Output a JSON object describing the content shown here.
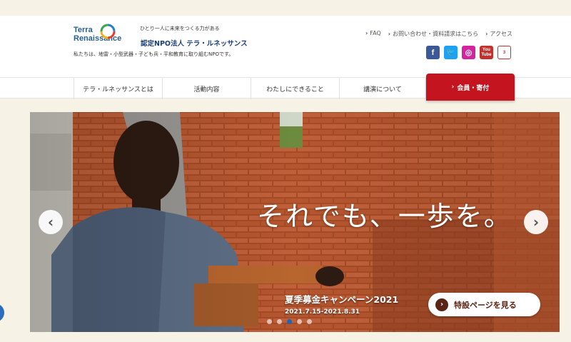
{
  "header": {
    "logo_line1": "Terra",
    "logo_line2": "Renaissance",
    "tagline": "ひとり一人に未来をつくる力がある",
    "org_name": "認定NPO法人 テラ・ルネッサンス",
    "org_desc": "私たちは、地雷・小型武器・子ども兵・平和教育に取り組むNPOです。"
  },
  "util_links": [
    "FAQ",
    "お問い合わせ・資料請求はこちら",
    "アクセス"
  ],
  "social": [
    {
      "name": "facebook-icon",
      "glyph": "f"
    },
    {
      "name": "twitter-icon",
      "glyph": "🐦"
    },
    {
      "name": "instagram-icon",
      "glyph": "◎"
    },
    {
      "name": "youtube-icon",
      "glyph": "You Tube"
    },
    {
      "name": "raisers3-icon",
      "glyph": "3"
    }
  ],
  "nav": {
    "items": [
      "テラ・ルネッサンスとは",
      "活動内容",
      "わたしにできること",
      "講演について"
    ],
    "donate": "会員・寄付"
  },
  "hero": {
    "slogan": "それでも、一歩を。",
    "campaign_title": "夏季募金キャンペーン2021",
    "campaign_dates": "2021.7.15-2021.8.31",
    "special_button": "特設ページを見る",
    "active_slide": 3,
    "slide_count": 5
  },
  "colors": {
    "brand_red": "#c41420",
    "brand_navy": "#1a3f77",
    "cream": "#f6f2e6"
  }
}
